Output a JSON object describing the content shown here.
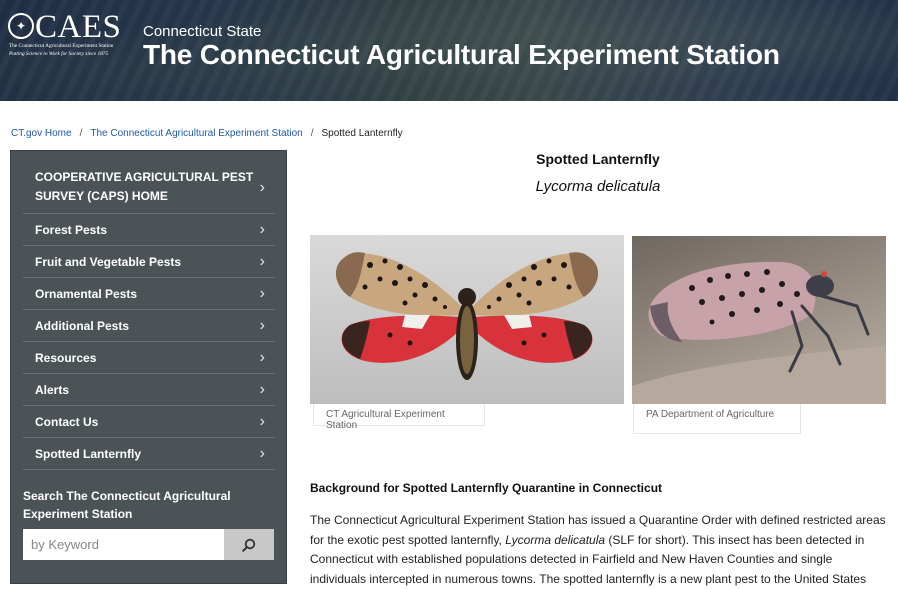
{
  "header": {
    "logo_text": "CAES",
    "logo_line1": "The Connecticut Agricultural Experiment Station",
    "logo_line2": "Putting Science to Work for Society since 1875",
    "state": "Connecticut State",
    "title": "The Connecticut Agricultural Experiment Station"
  },
  "breadcrumb": {
    "items": [
      {
        "label": "CT.gov Home"
      },
      {
        "label": "The Connecticut Agricultural Experiment Station"
      }
    ],
    "separator": "/",
    "current": "Spotted Lanternfly"
  },
  "sidebar": {
    "items": [
      {
        "label": "COOPERATIVE AGRICULTURAL PEST SURVEY (CAPS) HOME"
      },
      {
        "label": "Forest Pests"
      },
      {
        "label": "Fruit and Vegetable Pests"
      },
      {
        "label": "Ornamental Pests"
      },
      {
        "label": "Additional Pests"
      },
      {
        "label": "Resources"
      },
      {
        "label": "Alerts"
      },
      {
        "label": "Contact Us"
      },
      {
        "label": "Spotted Lanternfly"
      }
    ],
    "chevron": "›",
    "search_label": "Search The Connecticut Agricultural Experiment Station",
    "search_placeholder": "by Keyword",
    "search_icon": "search-icon"
  },
  "main": {
    "title": "Spotted Lanternfly",
    "scientific_name": "Lycorma delicatula",
    "images": [
      {
        "caption": "CT Agricultural Experiment Station"
      },
      {
        "caption": "PA Department of Agriculture"
      }
    ],
    "section_heading": "Background for Spotted Lanternfly Quarantine in Connecticut",
    "paragraph": {
      "part1": "The Connecticut Agricultural Experiment Station has issued a Quarantine Order with defined restricted areas for the exotic pest spotted lanternfly, ",
      "italic": "Lycorma delicatula",
      "part2": " (SLF for short). This insect has been detected in Connecticut with established populations detected in Fairfield and New Haven Counties and single individuals intercepted in numerous towns. The spotted lanternfly is a new plant pest to the United States"
    }
  },
  "colors": {
    "link": "#1e5aa8",
    "sidebar_bg": "#4c5357",
    "search_button_bg": "#c8c8c8"
  }
}
